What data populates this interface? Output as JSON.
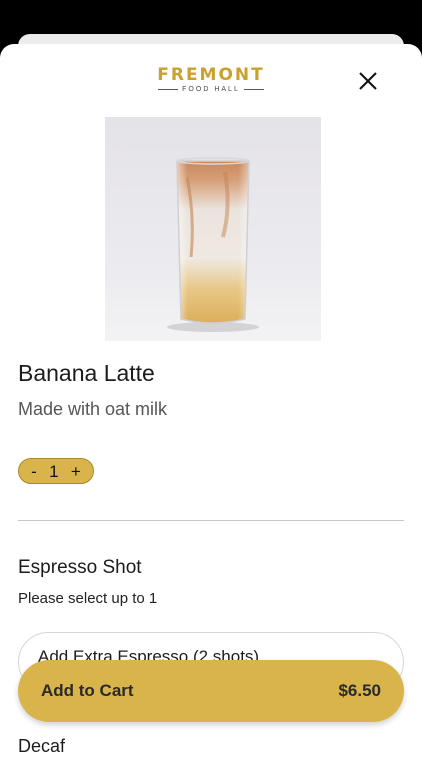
{
  "brand": {
    "name": "FREMONT",
    "subname": "FOOD HALL",
    "accent_color": "#c9a12f"
  },
  "close_icon": "close-icon",
  "product": {
    "image_icon": "iced-latte-image",
    "name": "Banana Latte",
    "description": "Made with oat milk"
  },
  "quantity": {
    "decrement_label": "-",
    "value": "1",
    "increment_label": "+"
  },
  "modifier_group": {
    "title": "Espresso Shot",
    "instruction": "Please select up to 1",
    "option_label": "Add Extra Espresso (2 shots)"
  },
  "next_group": {
    "title": "Decaf"
  },
  "cart_button": {
    "label": "Add to Cart",
    "price": "$6.50",
    "color": "#d9b44a"
  }
}
